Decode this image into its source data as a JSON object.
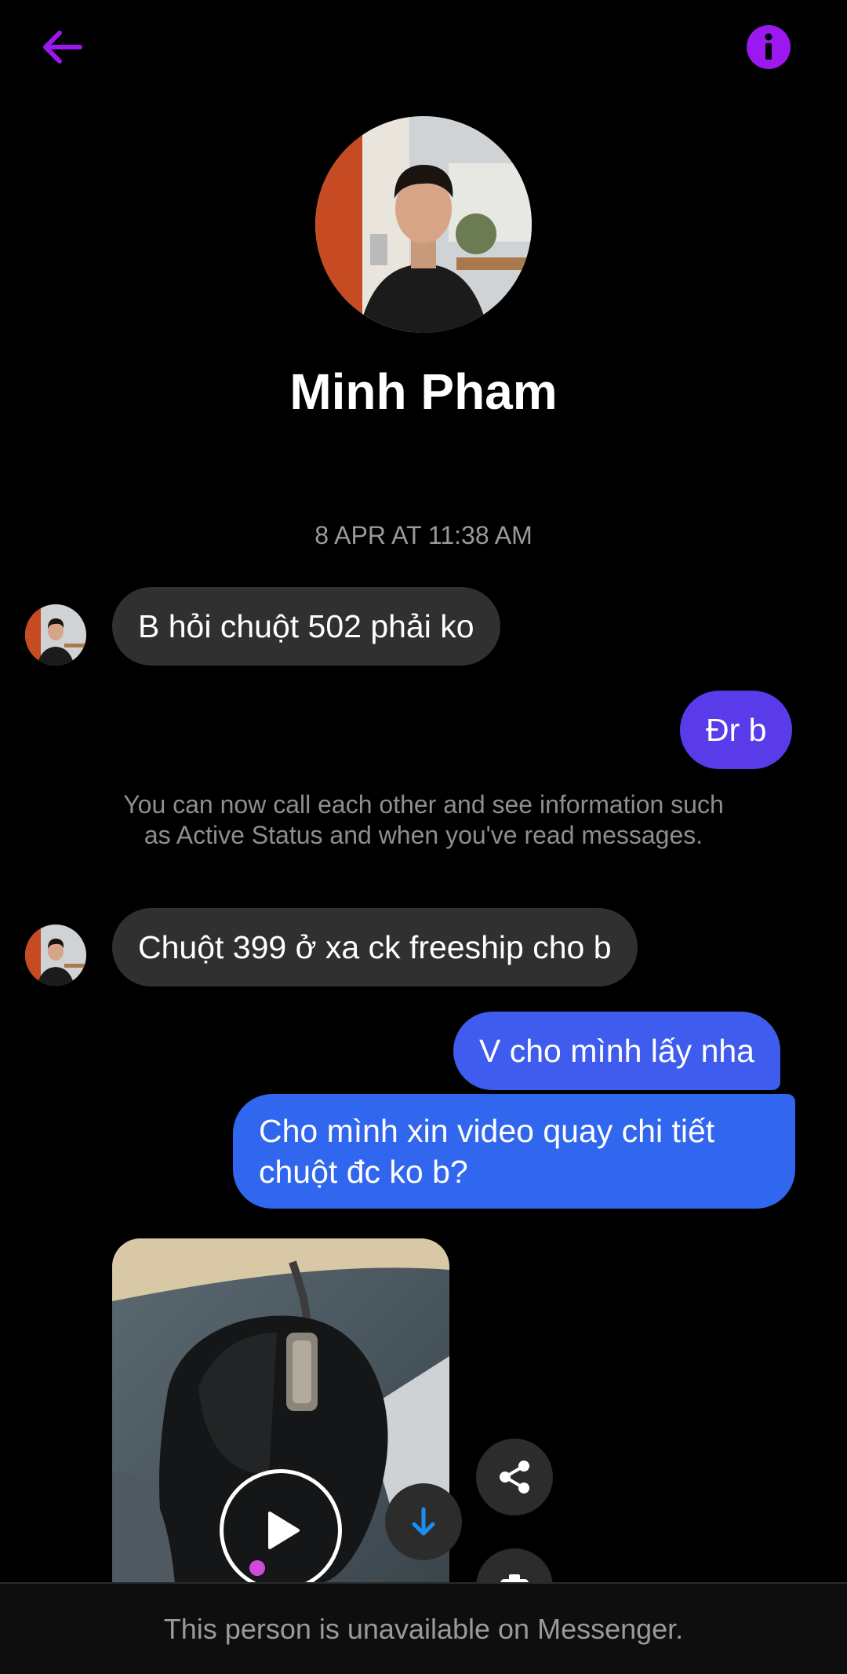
{
  "header": {
    "back_icon": "arrow-left-icon",
    "info_icon": "info-icon",
    "accent": "#9b18ef"
  },
  "profile": {
    "name": "Minh Pham"
  },
  "conversation": {
    "timestamp": "8 APR AT 11:38 AM",
    "messages": [
      {
        "side": "incoming",
        "text": "B hỏi chuột 502 phải ko"
      },
      {
        "side": "outgoing",
        "text": "Đr b",
        "color": "#5a3bea"
      },
      {
        "side": "system",
        "text": "You can now call each other and see information such as Active Status and when you've read messages."
      },
      {
        "side": "incoming",
        "text": "Chuột 399 ở xa ck freeship cho b"
      },
      {
        "side": "outgoing",
        "text": "V cho mình lấy nha",
        "color": "#3f5cee"
      },
      {
        "side": "outgoing",
        "lines": [
          "Cho mình xin video quay chi tiết",
          "chuột đc ko b?"
        ],
        "color": "#3166ee"
      },
      {
        "side": "incoming",
        "type": "video"
      }
    ],
    "video_actions": {
      "play_icon": "play-icon",
      "download_icon": "download-icon",
      "share_icon": "share-icon",
      "camera_icon": "camera-icon"
    }
  },
  "footer": {
    "status_text": "This person is unavailable on Messenger."
  }
}
